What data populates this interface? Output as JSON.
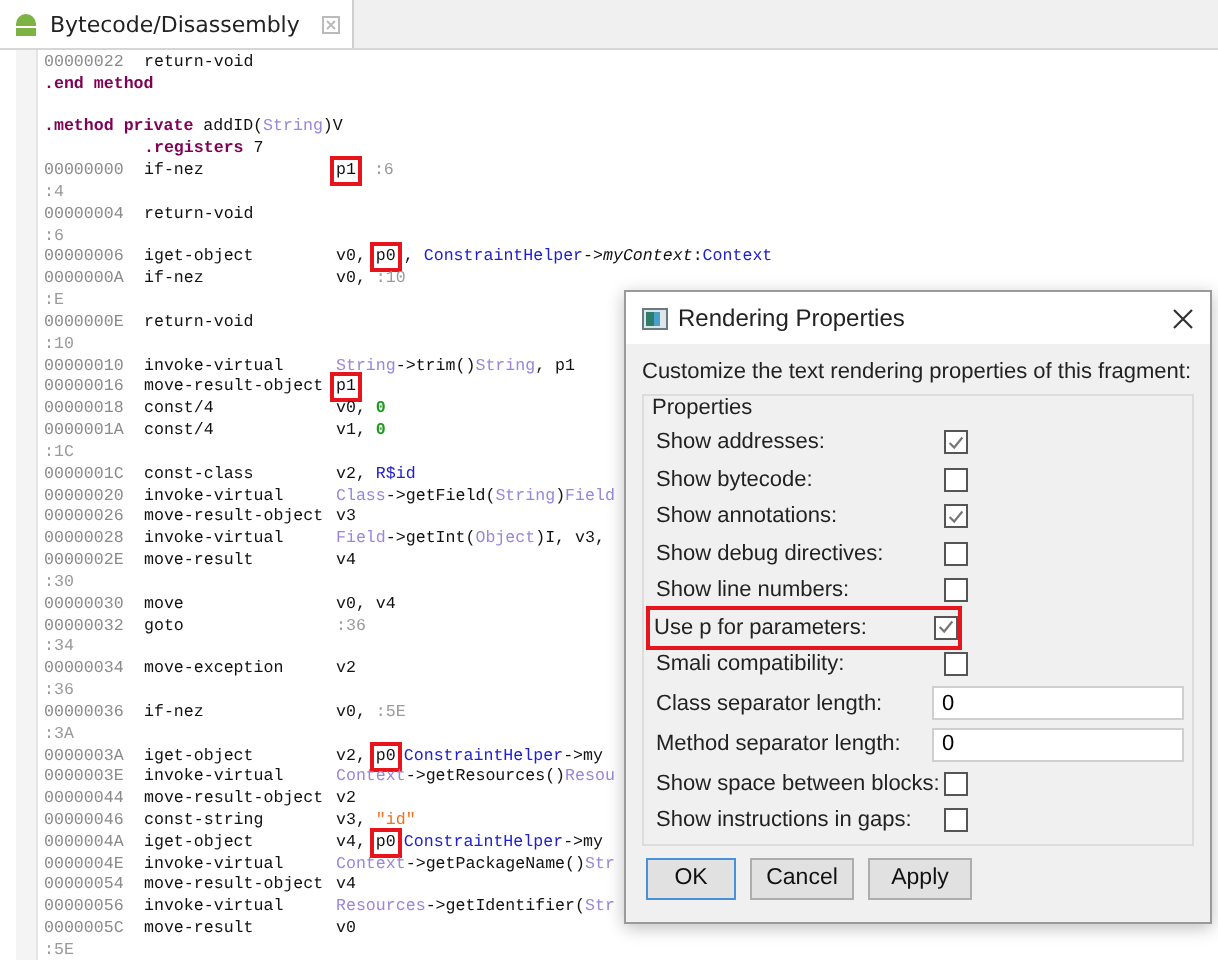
{
  "editor_tab": {
    "title": "Bytecode/Disassembly",
    "selected": true
  },
  "code_lines": [
    {
      "kind": "instr",
      "address": "00000022",
      "opcode": "return-void"
    },
    {
      "kind": "directive",
      "segments": [
        {
          "text": ".end method",
          "kind": "keyword"
        }
      ]
    },
    {
      "kind": "blank"
    },
    {
      "kind": "directive",
      "segments": [
        {
          "text": ".method private",
          "kind": "keyword"
        },
        {
          "text": " addID(",
          "kind": "plain"
        },
        {
          "text": "String",
          "kind": "type"
        },
        {
          "text": ")V",
          "kind": "plain"
        }
      ]
    },
    {
      "kind": "subdirective",
      "segments": [
        {
          "text": ".registers",
          "kind": "keyword"
        },
        {
          "text": " 7",
          "kind": "plain"
        }
      ]
    },
    {
      "kind": "instr",
      "address": "00000000",
      "opcode": "if-nez",
      "operands": [
        {
          "text": "p1",
          "kind": "boxed"
        },
        {
          "text": " :6",
          "kind": "label"
        }
      ]
    },
    {
      "kind": "label",
      "text": ":4"
    },
    {
      "kind": "instr",
      "address": "00000004",
      "opcode": "return-void"
    },
    {
      "kind": "label",
      "text": ":6"
    },
    {
      "kind": "instr",
      "address": "00000006",
      "opcode": "iget-object",
      "operands": [
        {
          "text": "v0, ",
          "kind": "plain"
        },
        {
          "text": "p0",
          "kind": "boxed"
        },
        {
          "text": ", ",
          "kind": "plain"
        },
        {
          "text": "ConstraintHelper",
          "kind": "ref"
        },
        {
          "text": "->",
          "kind": "plain"
        },
        {
          "text": "myContext",
          "kind": "italic"
        },
        {
          "text": ":",
          "kind": "plain"
        },
        {
          "text": "Context",
          "kind": "ref"
        }
      ]
    },
    {
      "kind": "instr",
      "address": "0000000A",
      "opcode": "if-nez",
      "operands": [
        {
          "text": "v0, ",
          "kind": "plain"
        },
        {
          "text": ":10",
          "kind": "label"
        }
      ]
    },
    {
      "kind": "label",
      "text": ":E"
    },
    {
      "kind": "instr",
      "address": "0000000E",
      "opcode": "return-void"
    },
    {
      "kind": "label",
      "text": ":10"
    },
    {
      "kind": "instr",
      "address": "00000010",
      "opcode": "invoke-virtual",
      "operands": [
        {
          "text": "String",
          "kind": "type"
        },
        {
          "text": "->trim()",
          "kind": "plain"
        },
        {
          "text": "String",
          "kind": "type"
        },
        {
          "text": ", p1",
          "kind": "plain"
        }
      ]
    },
    {
      "kind": "instr",
      "address": "00000016",
      "opcode": "move-result-object",
      "operands": [
        {
          "text": "p1",
          "kind": "boxed"
        }
      ]
    },
    {
      "kind": "instr",
      "address": "00000018",
      "opcode": "const/4",
      "operands": [
        {
          "text": "v0, ",
          "kind": "plain"
        },
        {
          "text": "0",
          "kind": "num"
        }
      ]
    },
    {
      "kind": "instr",
      "address": "0000001A",
      "opcode": "const/4",
      "operands": [
        {
          "text": "v1, ",
          "kind": "plain"
        },
        {
          "text": "0",
          "kind": "num"
        }
      ]
    },
    {
      "kind": "label",
      "text": ":1C"
    },
    {
      "kind": "instr",
      "address": "0000001C",
      "opcode": "const-class",
      "operands": [
        {
          "text": "v2, ",
          "kind": "plain"
        },
        {
          "text": "R$id",
          "kind": "ref"
        }
      ]
    },
    {
      "kind": "instr",
      "address": "00000020",
      "opcode": "invoke-virtual",
      "operands": [
        {
          "text": "Class",
          "kind": "type"
        },
        {
          "text": "->getField(",
          "kind": "plain"
        },
        {
          "text": "String",
          "kind": "type"
        },
        {
          "text": ")",
          "kind": "plain"
        },
        {
          "text": "Field",
          "kind": "type"
        }
      ]
    },
    {
      "kind": "instr",
      "address": "00000026",
      "opcode": "move-result-object",
      "operands": [
        {
          "text": "v3",
          "kind": "plain"
        }
      ]
    },
    {
      "kind": "instr",
      "address": "00000028",
      "opcode": "invoke-virtual",
      "operands": [
        {
          "text": "Field",
          "kind": "type"
        },
        {
          "text": "->getInt(",
          "kind": "plain"
        },
        {
          "text": "Object",
          "kind": "type"
        },
        {
          "text": ")I, v3,",
          "kind": "plain"
        }
      ]
    },
    {
      "kind": "instr",
      "address": "0000002E",
      "opcode": "move-result",
      "operands": [
        {
          "text": "v4",
          "kind": "plain"
        }
      ]
    },
    {
      "kind": "label",
      "text": ":30"
    },
    {
      "kind": "instr",
      "address": "00000030",
      "opcode": "move",
      "operands": [
        {
          "text": "v0, v4",
          "kind": "plain"
        }
      ]
    },
    {
      "kind": "instr",
      "address": "00000032",
      "opcode": "goto",
      "operands": [
        {
          "text": ":36",
          "kind": "label"
        }
      ]
    },
    {
      "kind": "label",
      "text": ":34"
    },
    {
      "kind": "instr",
      "address": "00000034",
      "opcode": "move-exception",
      "operands": [
        {
          "text": "v2",
          "kind": "plain"
        }
      ]
    },
    {
      "kind": "label",
      "text": ":36"
    },
    {
      "kind": "instr",
      "address": "00000036",
      "opcode": "if-nez",
      "operands": [
        {
          "text": "v0, ",
          "kind": "plain"
        },
        {
          "text": ":5E",
          "kind": "label"
        }
      ]
    },
    {
      "kind": "label",
      "text": ":3A"
    },
    {
      "kind": "instr",
      "address": "0000003A",
      "opcode": "iget-object",
      "operands": [
        {
          "text": "v2, ",
          "kind": "plain"
        },
        {
          "text": "p0",
          "kind": "boxed"
        },
        {
          "text": "ConstraintHelper",
          "kind": "ref"
        },
        {
          "text": "->my",
          "kind": "plain"
        }
      ]
    },
    {
      "kind": "instr",
      "address": "0000003E",
      "opcode": "invoke-virtual",
      "operands": [
        {
          "text": "Context",
          "kind": "type"
        },
        {
          "text": "->getResources()",
          "kind": "plain"
        },
        {
          "text": "Resou",
          "kind": "type"
        }
      ]
    },
    {
      "kind": "instr",
      "address": "00000044",
      "opcode": "move-result-object",
      "operands": [
        {
          "text": "v2",
          "kind": "plain"
        }
      ]
    },
    {
      "kind": "instr",
      "address": "00000046",
      "opcode": "const-string",
      "operands": [
        {
          "text": "v3, ",
          "kind": "plain"
        },
        {
          "text": "\"id\"",
          "kind": "str"
        }
      ]
    },
    {
      "kind": "instr",
      "address": "0000004A",
      "opcode": "iget-object",
      "operands": [
        {
          "text": "v4, ",
          "kind": "plain"
        },
        {
          "text": "p0",
          "kind": "boxed"
        },
        {
          "text": "ConstraintHelper",
          "kind": "ref"
        },
        {
          "text": "->my",
          "kind": "plain"
        }
      ]
    },
    {
      "kind": "instr",
      "address": "0000004E",
      "opcode": "invoke-virtual",
      "operands": [
        {
          "text": "Context",
          "kind": "type"
        },
        {
          "text": "->getPackageName()",
          "kind": "plain"
        },
        {
          "text": "Str",
          "kind": "type"
        }
      ]
    },
    {
      "kind": "instr",
      "address": "00000054",
      "opcode": "move-result-object",
      "operands": [
        {
          "text": "v4",
          "kind": "plain"
        }
      ]
    },
    {
      "kind": "instr",
      "address": "00000056",
      "opcode": "invoke-virtual",
      "operands": [
        {
          "text": "Resources",
          "kind": "type"
        },
        {
          "text": "->getIdentifier(",
          "kind": "plain"
        },
        {
          "text": "Str",
          "kind": "type"
        }
      ]
    },
    {
      "kind": "instr",
      "address": "0000005C",
      "opcode": "move-result",
      "operands": [
        {
          "text": "v0",
          "kind": "plain"
        }
      ]
    },
    {
      "kind": "label",
      "text": ":5E"
    }
  ],
  "dialog": {
    "title": "Rendering Properties",
    "description": "Customize the text rendering properties of this fragment:",
    "group_title": "Properties",
    "rows": [
      {
        "kind": "checkbox",
        "label": "Show addresses:",
        "checked": true
      },
      {
        "kind": "checkbox",
        "label": "Show bytecode:",
        "checked": false
      },
      {
        "kind": "checkbox",
        "label": "Show annotations:",
        "checked": true
      },
      {
        "kind": "checkbox",
        "label": "Show debug directives:",
        "checked": false
      },
      {
        "kind": "checkbox",
        "label": "Show line numbers:",
        "checked": false
      },
      {
        "kind": "checkbox",
        "label": "Use p for parameters:",
        "checked": true,
        "highlighted": true
      },
      {
        "kind": "checkbox",
        "label": "Smali compatibility:",
        "checked": false
      },
      {
        "kind": "field",
        "label": "Class separator length:",
        "value": "0"
      },
      {
        "kind": "field",
        "label": "Method separator length:",
        "value": "0"
      },
      {
        "kind": "checkbox",
        "label": "Show space between blocks:",
        "checked": false
      },
      {
        "kind": "checkbox",
        "label": "Show instructions in gaps:",
        "checked": false
      }
    ],
    "buttons": [
      "OK",
      "Cancel",
      "Apply"
    ]
  }
}
